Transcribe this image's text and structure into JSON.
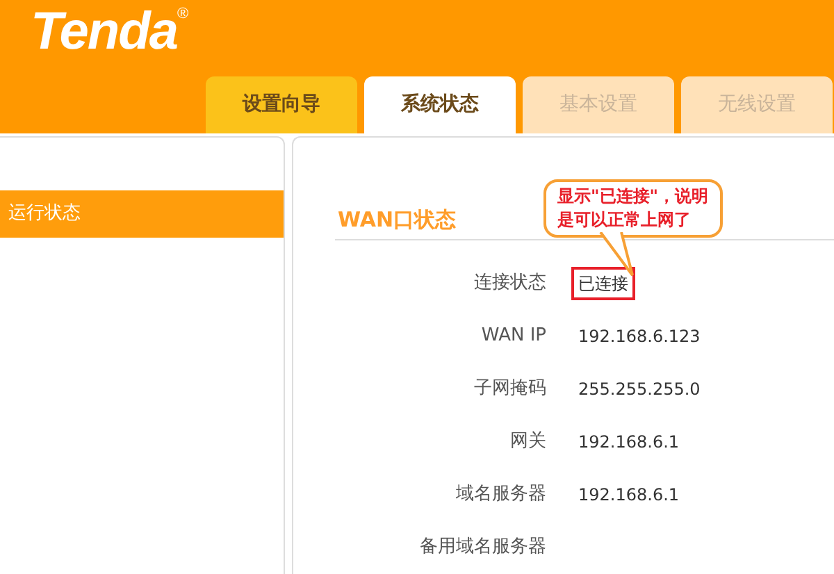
{
  "logo": {
    "text": "Tenda",
    "mark": "®"
  },
  "tabs": [
    {
      "label": "设置向导",
      "selected": false
    },
    {
      "label": "系统状态",
      "selected": true
    },
    {
      "label": "基本设置",
      "selected": false
    },
    {
      "label": "无线设置",
      "selected": false
    }
  ],
  "sidebar": {
    "items": [
      {
        "label": "运行状态",
        "selected": true
      }
    ]
  },
  "section": {
    "title": "WAN口状态",
    "rows": [
      {
        "label": "连接状态",
        "value": "已连接",
        "highlighted": true
      },
      {
        "label": "WAN IP",
        "value": "192.168.6.123",
        "highlighted": false
      },
      {
        "label": "子网掩码",
        "value": "255.255.255.0",
        "highlighted": false
      },
      {
        "label": "网关",
        "value": "192.168.6.1",
        "highlighted": false
      },
      {
        "label": "域名服务器",
        "value": "192.168.6.1",
        "highlighted": false
      },
      {
        "label": "备用域名服务器",
        "value": "",
        "highlighted": false
      }
    ]
  },
  "callout": {
    "lines": [
      "显示\"已连接\"，说明",
      "是可以正常上网了"
    ]
  }
}
